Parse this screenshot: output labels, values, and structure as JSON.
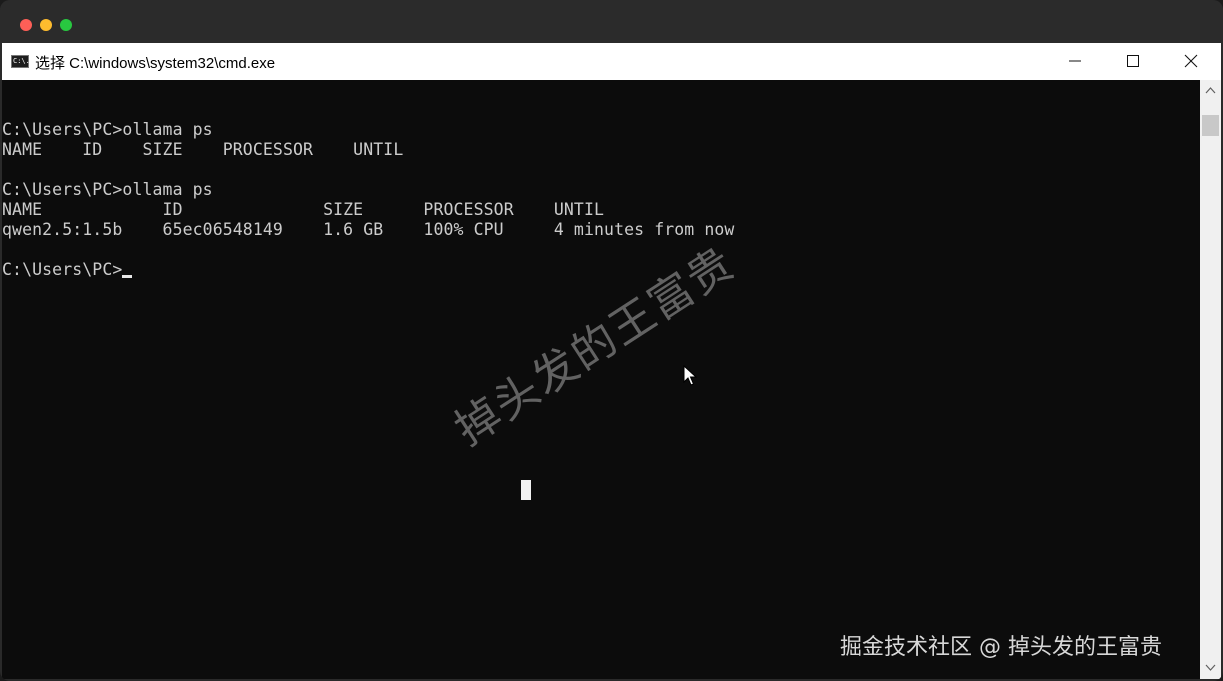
{
  "colors": {
    "console_bg": "#0c0c0c",
    "console_text": "#cccccc",
    "titlebar_bg": "#ffffff",
    "mac_red": "#fe5f57",
    "mac_yellow": "#febc2e",
    "mac_green": "#28c840"
  },
  "window": {
    "icon_name": "cmd-icon",
    "icon_glyph": "C:\\.",
    "title": "选择 C:\\windows\\system32\\cmd.exe",
    "controls": [
      "minimize-icon",
      "maximize-icon",
      "close-icon"
    ]
  },
  "console": {
    "lines": [
      "C:\\Users\\PC>ollama ps",
      "NAME    ID    SIZE    PROCESSOR    UNTIL",
      "",
      "C:\\Users\\PC>ollama ps",
      "NAME            ID              SIZE      PROCESSOR    UNTIL",
      "qwen2.5:1.5b    65ec06548149    1.6 GB    100% CPU     4 minutes from now",
      "",
      "C:\\Users\\PC>"
    ]
  },
  "overlay": {
    "watermark": "掉头发的王富贵",
    "credit": "掘金技术社区 @ 掉头发的王富贵"
  },
  "scrollbar": {
    "up_icon": "scroll-up-arrow-icon",
    "down_icon": "scroll-down-arrow-icon"
  }
}
